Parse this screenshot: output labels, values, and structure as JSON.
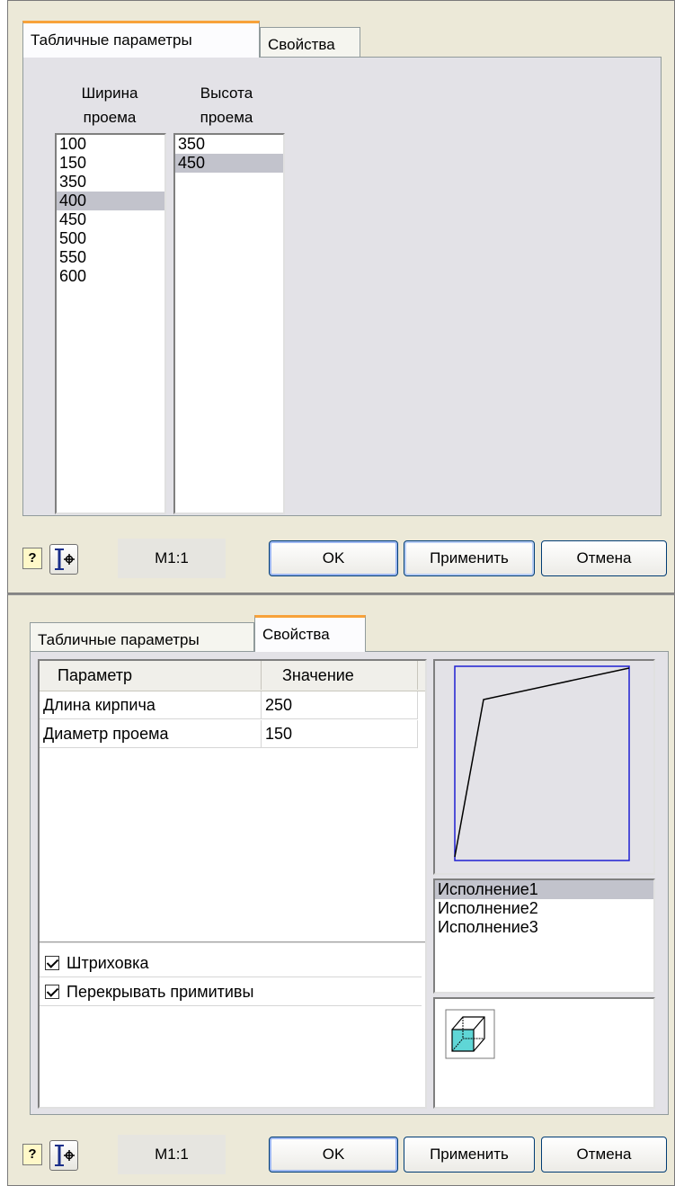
{
  "tabs": {
    "table_params": "Табличные параметры",
    "properties": "Свойства"
  },
  "table_panel": {
    "col1_header": [
      "Ширина",
      "проема"
    ],
    "col2_header": [
      "Высота",
      "проема"
    ],
    "widths": [
      "100",
      "150",
      "350",
      "400",
      "450",
      "500",
      "550",
      "600"
    ],
    "selected_width": "400",
    "heights": [
      "350",
      "450"
    ],
    "selected_height": "450"
  },
  "props_panel": {
    "grid_headers": {
      "param": "Параметр",
      "value": "Значение"
    },
    "rows": [
      {
        "param": "Длина кирпича",
        "value": "250"
      },
      {
        "param": "Диаметр проема",
        "value": "150"
      }
    ],
    "checks": [
      {
        "label": "Штриховка",
        "checked": true
      },
      {
        "label": "Перекрывать примитивы",
        "checked": true
      }
    ],
    "variants": [
      "Исполнение1",
      "Исполнение2",
      "Исполнение3"
    ],
    "selected_variant": "Исполнение1"
  },
  "footer": {
    "help_icon": "question-icon",
    "ortho_icon": "ortho-snap-icon",
    "scale": "М1:1",
    "ok": "OK",
    "apply": "Применить",
    "cancel": "Отмена"
  },
  "colors": {
    "tab_accent": "#f7a23a",
    "selection": "#c2c3cc",
    "preview_border": "#1f1fd2",
    "cube_face": "#5fd6d6"
  }
}
